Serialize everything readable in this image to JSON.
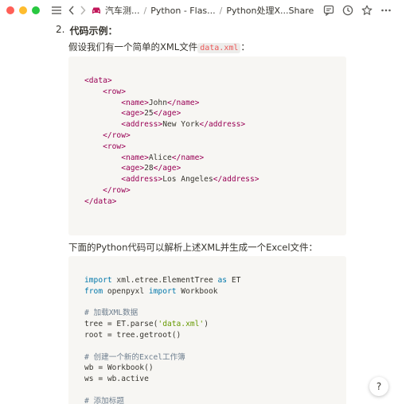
{
  "breadcrumbs": [
    {
      "label": "汽车测..."
    },
    {
      "label": "Python - Flas..."
    },
    {
      "label": "Python处理X..."
    }
  ],
  "toolbar": {
    "share_label": "Share"
  },
  "content": {
    "list_number": "2.",
    "list_title": "代码示例",
    "list_colon": "：",
    "para1_prefix": "假设我们有一个简单的XML文件",
    "para1_code": "data.xml",
    "para1_suffix": "：",
    "para2": "下面的Python代码可以解析上述XML并生成一个Excel文件："
  },
  "xml_code": [
    {
      "indent": "",
      "open": "<data>",
      "text": "",
      "close": ""
    },
    {
      "indent": "    ",
      "open": "<row>",
      "text": "",
      "close": ""
    },
    {
      "indent": "        ",
      "open": "<name>",
      "text": "John",
      "close": "</name>"
    },
    {
      "indent": "        ",
      "open": "<age>",
      "text": "25",
      "close": "</age>"
    },
    {
      "indent": "        ",
      "open": "<address>",
      "text": "New York",
      "close": "</address>"
    },
    {
      "indent": "    ",
      "open": "</row>",
      "text": "",
      "close": ""
    },
    {
      "indent": "    ",
      "open": "<row>",
      "text": "",
      "close": ""
    },
    {
      "indent": "        ",
      "open": "<name>",
      "text": "Alice",
      "close": "</name>"
    },
    {
      "indent": "        ",
      "open": "<age>",
      "text": "28",
      "close": "</age>"
    },
    {
      "indent": "        ",
      "open": "<address>",
      "text": "Los Angeles",
      "close": "</address>"
    },
    {
      "indent": "    ",
      "open": "</row>",
      "text": "",
      "close": ""
    },
    {
      "indent": "",
      "open": "</data>",
      "text": "",
      "close": ""
    }
  ],
  "py_code": [
    [
      {
        "t": "import",
        "c": "kw"
      },
      {
        "t": " xml.etree.ElementTree ",
        "c": ""
      },
      {
        "t": "as",
        "c": "kw"
      },
      {
        "t": " ET",
        "c": ""
      }
    ],
    [
      {
        "t": "from",
        "c": "kw"
      },
      {
        "t": " openpyxl ",
        "c": ""
      },
      {
        "t": "import",
        "c": "kw"
      },
      {
        "t": " Workbook",
        "c": ""
      }
    ],
    [],
    [
      {
        "t": "# 加载XML数据",
        "c": "cmt"
      }
    ],
    [
      {
        "t": "tree = ET.parse(",
        "c": ""
      },
      {
        "t": "'data.xml'",
        "c": "str"
      },
      {
        "t": ")",
        "c": ""
      }
    ],
    [
      {
        "t": "root = tree.getroot()",
        "c": ""
      }
    ],
    [],
    [
      {
        "t": "# 创建一个新的Excel工作簿",
        "c": "cmt"
      }
    ],
    [
      {
        "t": "wb = Workbook()",
        "c": ""
      }
    ],
    [
      {
        "t": "ws = wb.active",
        "c": ""
      }
    ],
    [],
    [
      {
        "t": "# 添加标题",
        "c": "cmt"
      }
    ]
  ],
  "help_label": "?",
  "colors": {
    "tag": "#990055",
    "keyword": "#0077aa",
    "string": "#669900",
    "comment": "#708090",
    "code_bg": "#f7f6f3"
  }
}
